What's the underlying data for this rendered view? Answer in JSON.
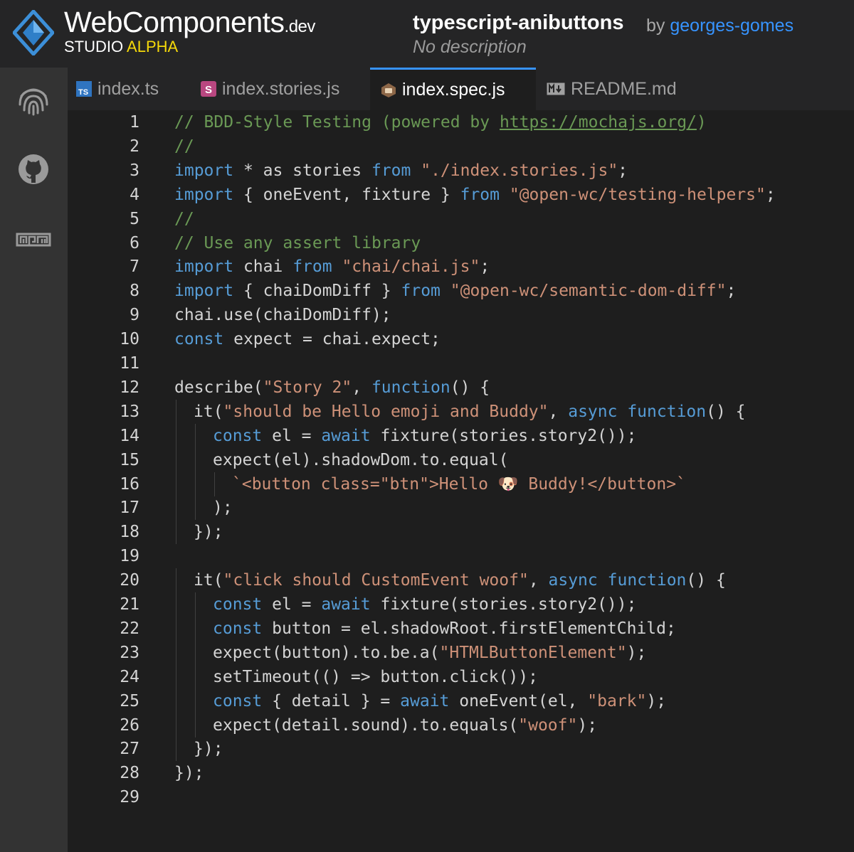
{
  "brand": {
    "name": "WebComponents",
    "suffix": ".dev",
    "studio": "STUDIO",
    "alpha": "ALPHA"
  },
  "project": {
    "title": "typescript-anibuttons",
    "by": "by",
    "author": "georges-gomes",
    "description": "No description"
  },
  "sidebar": {
    "items": [
      {
        "icon": "fingerprint-icon"
      },
      {
        "icon": "github-icon"
      },
      {
        "icon": "npm-icon"
      }
    ]
  },
  "tabs": [
    {
      "label": "index.ts",
      "icon": "typescript-icon",
      "active": false
    },
    {
      "label": "index.stories.js",
      "icon": "storybook-icon",
      "active": false
    },
    {
      "label": "index.spec.js",
      "icon": "mocha-icon",
      "active": true
    },
    {
      "label": "README.md",
      "icon": "markdown-icon",
      "active": false
    }
  ],
  "colors": {
    "comment": "#6a9955",
    "keyword": "#569cd6",
    "string": "#ce9178",
    "text": "#d4d4d4",
    "accent": "#3794ff",
    "alpha": "#f5d90a"
  },
  "editor": {
    "lines": [
      {
        "n": "1",
        "indent": 0,
        "tokens": [
          [
            "c",
            "// BDD-Style Testing (powered by "
          ],
          [
            "u",
            "https://mochajs.org/"
          ],
          [
            "c",
            ")"
          ]
        ]
      },
      {
        "n": "2",
        "indent": 0,
        "tokens": [
          [
            "c",
            "//"
          ]
        ]
      },
      {
        "n": "3",
        "indent": 0,
        "tokens": [
          [
            "k",
            "import"
          ],
          [
            "p",
            " * as stories "
          ],
          [
            "k",
            "from"
          ],
          [
            "p",
            " "
          ],
          [
            "s",
            "\"./index.stories.js\""
          ],
          [
            "p",
            ";"
          ]
        ]
      },
      {
        "n": "4",
        "indent": 0,
        "tokens": [
          [
            "k",
            "import"
          ],
          [
            "p",
            " { oneEvent, fixture } "
          ],
          [
            "k",
            "from"
          ],
          [
            "p",
            " "
          ],
          [
            "s",
            "\"@open-wc/testing-helpers\""
          ],
          [
            "p",
            ";"
          ]
        ]
      },
      {
        "n": "5",
        "indent": 0,
        "tokens": [
          [
            "c",
            "//"
          ]
        ]
      },
      {
        "n": "6",
        "indent": 0,
        "tokens": [
          [
            "c",
            "// Use any assert library"
          ]
        ]
      },
      {
        "n": "7",
        "indent": 0,
        "tokens": [
          [
            "k",
            "import"
          ],
          [
            "p",
            " chai "
          ],
          [
            "k",
            "from"
          ],
          [
            "p",
            " "
          ],
          [
            "s",
            "\"chai/chai.js\""
          ],
          [
            "p",
            ";"
          ]
        ]
      },
      {
        "n": "8",
        "indent": 0,
        "tokens": [
          [
            "k",
            "import"
          ],
          [
            "p",
            " { chaiDomDiff } "
          ],
          [
            "k",
            "from"
          ],
          [
            "p",
            " "
          ],
          [
            "s",
            "\"@open-wc/semantic-dom-diff\""
          ],
          [
            "p",
            ";"
          ]
        ]
      },
      {
        "n": "9",
        "indent": 0,
        "tokens": [
          [
            "p",
            "chai.use(chaiDomDiff);"
          ]
        ]
      },
      {
        "n": "10",
        "indent": 0,
        "tokens": [
          [
            "k",
            "const"
          ],
          [
            "p",
            " expect = chai.expect;"
          ]
        ]
      },
      {
        "n": "11",
        "indent": 0,
        "tokens": []
      },
      {
        "n": "12",
        "indent": 0,
        "tokens": [
          [
            "p",
            "describe("
          ],
          [
            "s",
            "\"Story 2\""
          ],
          [
            "p",
            ", "
          ],
          [
            "k",
            "function"
          ],
          [
            "p",
            "() {"
          ]
        ]
      },
      {
        "n": "13",
        "indent": 1,
        "tokens": [
          [
            "p",
            "it("
          ],
          [
            "s",
            "\"should be Hello emoji and Buddy\""
          ],
          [
            "p",
            ", "
          ],
          [
            "k",
            "async"
          ],
          [
            "p",
            " "
          ],
          [
            "k",
            "function"
          ],
          [
            "p",
            "() {"
          ]
        ]
      },
      {
        "n": "14",
        "indent": 2,
        "tokens": [
          [
            "k",
            "const"
          ],
          [
            "p",
            " el = "
          ],
          [
            "k",
            "await"
          ],
          [
            "p",
            " fixture(stories.story2());"
          ]
        ]
      },
      {
        "n": "15",
        "indent": 2,
        "tokens": [
          [
            "p",
            "expect(el).shadowDom.to.equal("
          ]
        ]
      },
      {
        "n": "16",
        "indent": 3,
        "tokens": [
          [
            "s",
            "`<button class=\"btn\">Hello 🐶 Buddy!</button>`"
          ]
        ]
      },
      {
        "n": "17",
        "indent": 2,
        "tokens": [
          [
            "p",
            ");"
          ]
        ]
      },
      {
        "n": "18",
        "indent": 1,
        "tokens": [
          [
            "p",
            "});"
          ]
        ]
      },
      {
        "n": "19",
        "indent": 0,
        "tokens": []
      },
      {
        "n": "20",
        "indent": 1,
        "tokens": [
          [
            "p",
            "it("
          ],
          [
            "s",
            "\"click should CustomEvent woof\""
          ],
          [
            "p",
            ", "
          ],
          [
            "k",
            "async"
          ],
          [
            "p",
            " "
          ],
          [
            "k",
            "function"
          ],
          [
            "p",
            "() {"
          ]
        ]
      },
      {
        "n": "21",
        "indent": 2,
        "tokens": [
          [
            "k",
            "const"
          ],
          [
            "p",
            " el = "
          ],
          [
            "k",
            "await"
          ],
          [
            "p",
            " fixture(stories.story2());"
          ]
        ]
      },
      {
        "n": "22",
        "indent": 2,
        "tokens": [
          [
            "k",
            "const"
          ],
          [
            "p",
            " button = el.shadowRoot.firstElementChild;"
          ]
        ]
      },
      {
        "n": "23",
        "indent": 2,
        "tokens": [
          [
            "p",
            "expect(button).to.be.a("
          ],
          [
            "s",
            "\"HTMLButtonElement\""
          ],
          [
            "p",
            ");"
          ]
        ]
      },
      {
        "n": "24",
        "indent": 2,
        "tokens": [
          [
            "p",
            "setTimeout(() => button.click());"
          ]
        ]
      },
      {
        "n": "25",
        "indent": 2,
        "tokens": [
          [
            "k",
            "const"
          ],
          [
            "p",
            " { detail } = "
          ],
          [
            "k",
            "await"
          ],
          [
            "p",
            " oneEvent(el, "
          ],
          [
            "s",
            "\"bark\""
          ],
          [
            "p",
            ");"
          ]
        ]
      },
      {
        "n": "26",
        "indent": 2,
        "tokens": [
          [
            "p",
            "expect(detail.sound).to.equals("
          ],
          [
            "s",
            "\"woof\""
          ],
          [
            "p",
            ");"
          ]
        ]
      },
      {
        "n": "27",
        "indent": 1,
        "tokens": [
          [
            "p",
            "});"
          ]
        ]
      },
      {
        "n": "28",
        "indent": 0,
        "tokens": [
          [
            "p",
            "});"
          ]
        ]
      },
      {
        "n": "29",
        "indent": 0,
        "tokens": []
      }
    ]
  }
}
